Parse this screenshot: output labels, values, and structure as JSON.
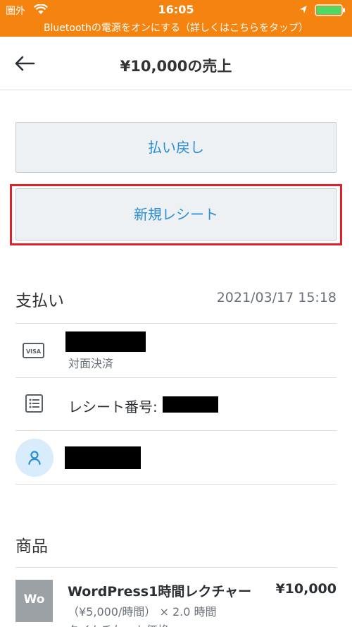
{
  "status_bar": {
    "carrier": "圏外",
    "time": "16:05"
  },
  "banner": {
    "text": "Bluetoothの電源をオンにする（詳しくはこちらをタップ）"
  },
  "nav": {
    "title": "¥10,000の売上"
  },
  "actions": {
    "refund_label": "払い戻し",
    "new_receipt_label": "新規レシート"
  },
  "payment": {
    "section_title": "支払い",
    "datetime": "2021/03/17 15:18",
    "card_type_label": "対面決済",
    "card_badge": "VISA",
    "receipt_number_label": "レシート番号:"
  },
  "items": {
    "section_title": "商品",
    "list": [
      {
        "thumb": "Wo",
        "name": "WordPress1時間レクチャー",
        "price": "¥10,000",
        "detail": "（¥5,000/時間） × 2.0 時間",
        "extra": "タイムチケット価格"
      }
    ]
  },
  "colors": {
    "status_bar": "#f5830f",
    "accent": "#2b8fd6",
    "highlight": "#e0212b"
  }
}
